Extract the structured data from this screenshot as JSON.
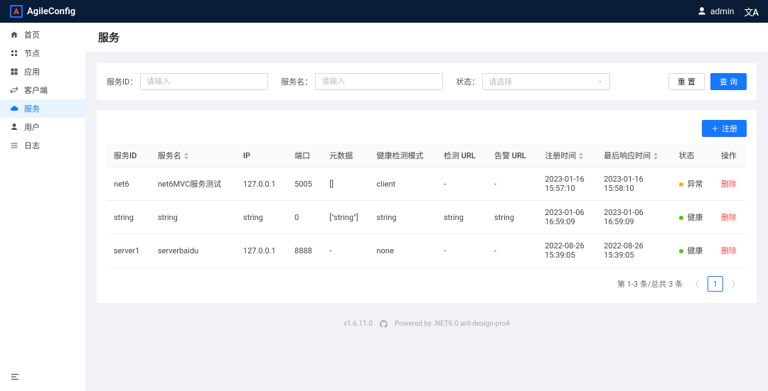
{
  "brand": "AgileConfig",
  "header": {
    "user_name": "admin",
    "lang_label": "文A"
  },
  "sidebar": {
    "items": [
      {
        "key": "home",
        "label": "首页",
        "icon": "home"
      },
      {
        "key": "nodes",
        "label": "节点",
        "icon": "cluster"
      },
      {
        "key": "apps",
        "label": "应用",
        "icon": "appstore"
      },
      {
        "key": "clients",
        "label": "客户端",
        "icon": "swap"
      },
      {
        "key": "services",
        "label": "服务",
        "icon": "cloud",
        "active": true
      },
      {
        "key": "users",
        "label": "用户",
        "icon": "user"
      },
      {
        "key": "logs",
        "label": "日志",
        "icon": "menu"
      }
    ]
  },
  "page": {
    "title": "服务"
  },
  "search": {
    "service_id_label": "服务ID：",
    "service_id_placeholder": "请输入",
    "service_name_label": "服务名：",
    "service_name_placeholder": "请输入",
    "status_label": "状态：",
    "status_placeholder": "请选择",
    "reset_label": "重 置",
    "query_label": "查 询"
  },
  "toolbar": {
    "register_label": "注册"
  },
  "table": {
    "columns": {
      "service_id": "服务ID",
      "service_name": "服务名",
      "ip": "IP",
      "port": "端口",
      "metadata": "元数据",
      "health_mode": "健康检测模式",
      "check_url": "检测 URL",
      "alarm_url": "告警 URL",
      "register_time": "注册时间",
      "last_resp_time": "最后响应时间",
      "status": "状态",
      "action": "操作"
    },
    "rows": [
      {
        "service_id": "net6",
        "service_name": "net6MVC服务测试",
        "ip": "127.0.0.1",
        "port": "5005",
        "metadata": "[]",
        "health_mode": "client",
        "check_url": "-",
        "alarm_url": "-",
        "register_time": "2023-01-16 15:57:10",
        "last_resp_time": "2023-01-16 15:58:10",
        "status": "异常",
        "status_color": "warn"
      },
      {
        "service_id": "string",
        "service_name": "string",
        "ip": "string",
        "port": "0",
        "metadata": "[\"string\"]",
        "health_mode": "string",
        "check_url": "string",
        "alarm_url": "string",
        "register_time": "2023-01-06 16:59:09",
        "last_resp_time": "2023-01-06 16:59:09",
        "status": "健康",
        "status_color": "ok"
      },
      {
        "service_id": "server1",
        "service_name": "serverbaidu",
        "ip": "127.0.0.1",
        "port": "8888",
        "metadata": "-",
        "health_mode": "none",
        "check_url": "-",
        "alarm_url": "-",
        "register_time": "2022-08-26 15:39:05",
        "last_resp_time": "2022-08-26 15:39:05",
        "status": "健康",
        "status_color": "ok"
      }
    ],
    "row_action_label": "删除"
  },
  "pagination": {
    "summary": "第 1-3 条/总共 3 条",
    "current": "1"
  },
  "footer": {
    "version": "v1.6.11.0",
    "powered": "Powered by .NET6.0 ant-design-pro4"
  }
}
